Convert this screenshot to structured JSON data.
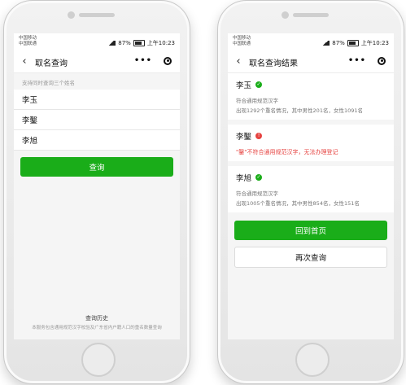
{
  "status_bar": {
    "carrier_top": "中国移动",
    "carrier_bottom": "中国联通",
    "battery": "87%",
    "time": "上午10:23"
  },
  "query_page": {
    "title": "取名查询",
    "hint": "支持同时查询三个姓名",
    "names": [
      "李玉",
      "李鑿",
      "李旭"
    ],
    "query_button": "查询",
    "history_title": "查询历史",
    "history_desc": "本服务包含通用规范汉字校验及广东省内户籍人口的重名数量查询"
  },
  "result_page": {
    "title": "取名查询结果",
    "results": [
      {
        "name": "李玉",
        "status": "ok",
        "line1": "符合通用规范汉字",
        "line2": "出现1292个重名情况，其中男性201名，女性1091名"
      },
      {
        "name": "李鑿",
        "status": "bad",
        "warning": "\"鑿\"不符合通用规范汉字，无法办理登记"
      },
      {
        "name": "李旭",
        "status": "ok",
        "line1": "符合通用规范汉字",
        "line2": "出现1005个重名情况，其中男性854名，女性151名"
      }
    ],
    "home_button": "回到首页",
    "again_button": "再次查询"
  },
  "colors": {
    "accent": "#1aad19",
    "error": "#e64340"
  },
  "icons": {
    "back": "chevron-left-icon",
    "more": "more-dots-icon",
    "close": "target-circle-icon",
    "ok": "check-circle-icon",
    "bad": "error-circle-icon"
  }
}
